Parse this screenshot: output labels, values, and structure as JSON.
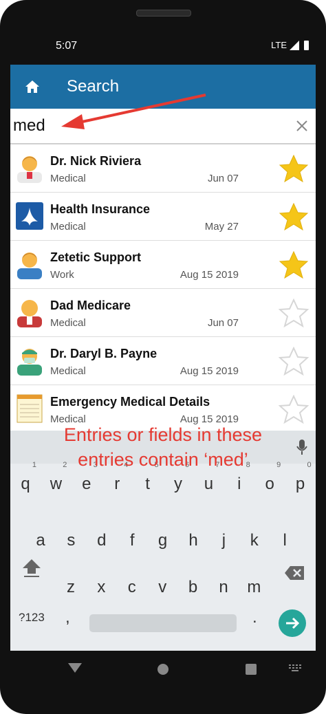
{
  "status": {
    "time": "5:07",
    "network": "LTE"
  },
  "appbar": {
    "title": "Search",
    "home_icon": "home-icon"
  },
  "search": {
    "value": "med",
    "clear_icon": "close-icon"
  },
  "entries": [
    {
      "title": "Dr. Nick Riviera",
      "category": "Medical",
      "date": "Jun 07",
      "icon": "doctor-avatar",
      "starred": true
    },
    {
      "title": "Health Insurance",
      "category": "Medical",
      "date": "May 27",
      "icon": "hhs-logo",
      "starred": true
    },
    {
      "title": "Zetetic Support",
      "category": "Work",
      "date": "Aug 15 2019",
      "icon": "person-avatar",
      "starred": true
    },
    {
      "title": "Dad Medicare",
      "category": "Medical",
      "date": "Jun 07",
      "icon": "bald-man-avatar",
      "starred": false
    },
    {
      "title": "Dr. Daryl B. Payne",
      "category": "Medical",
      "date": "Aug 15 2019",
      "icon": "surgeon-avatar",
      "starred": false
    },
    {
      "title": "Emergency Medical Details",
      "category": "Medical",
      "date": "Aug 15 2019",
      "icon": "notepad-icon",
      "starred": false
    }
  ],
  "annotation": {
    "line1": "Entries or fields in these",
    "line2": "entries contain ‘med’"
  },
  "keyboard": {
    "row1": [
      "q",
      "w",
      "e",
      "r",
      "t",
      "y",
      "u",
      "i",
      "o",
      "p"
    ],
    "row1_hints": [
      "1",
      "2",
      "3",
      "4",
      "5",
      "6",
      "7",
      "8",
      "9",
      "0"
    ],
    "row2": [
      "a",
      "s",
      "d",
      "f",
      "g",
      "h",
      "j",
      "k",
      "l"
    ],
    "row3": [
      "z",
      "x",
      "c",
      "v",
      "b",
      "n",
      "m"
    ],
    "sym_key": "?123",
    "comma": ",",
    "period": "."
  },
  "colors": {
    "appbar": "#1c6ea3",
    "star_on": "#f5c518",
    "annotation": "#e53a32",
    "enter": "#26a69a"
  }
}
